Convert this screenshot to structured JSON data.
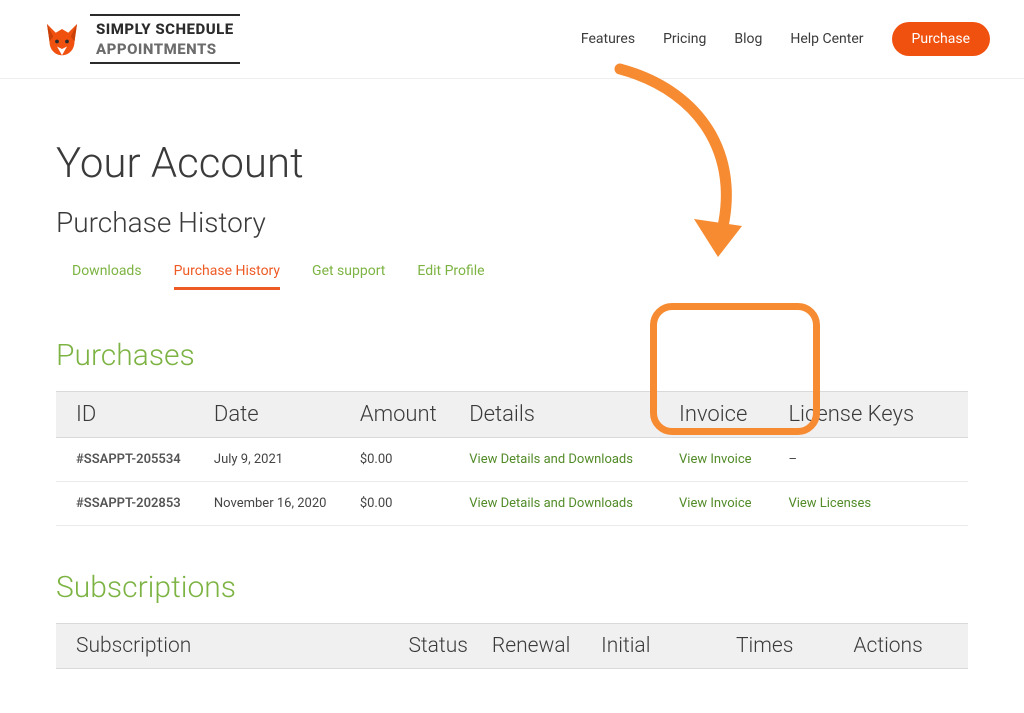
{
  "logo": {
    "line1": "SIMPLY SCHEDULE",
    "line2": "APPOINTMENTS"
  },
  "nav": {
    "features": "Features",
    "pricing": "Pricing",
    "blog": "Blog",
    "help": "Help Center",
    "purchase": "Purchase"
  },
  "page": {
    "title": "Your Account",
    "subtitle": "Purchase History"
  },
  "subnav": {
    "downloads": "Downloads",
    "history": "Purchase History",
    "support": "Get support",
    "profile": "Edit Profile"
  },
  "purchases": {
    "title": "Purchases",
    "headers": {
      "id": "ID",
      "date": "Date",
      "amount": "Amount",
      "details": "Details",
      "invoice": "Invoice",
      "license": "License Keys"
    },
    "rows": [
      {
        "id": "#SSAPPT-205534",
        "date": "July 9, 2021",
        "amount": "$0.00",
        "details": "View Details and Downloads",
        "invoice": "View Invoice",
        "license": "–"
      },
      {
        "id": "#SSAPPT-202853",
        "date": "November 16, 2020",
        "amount": "$0.00",
        "details": "View Details and Downloads",
        "invoice": "View Invoice",
        "license": "View Licenses"
      }
    ]
  },
  "subscriptions": {
    "title": "Subscriptions",
    "headers": {
      "subscription": "Subscription",
      "status": "Status",
      "renewal": "Renewal",
      "initial": "Initial",
      "times": "Times",
      "actions": "Actions"
    }
  }
}
